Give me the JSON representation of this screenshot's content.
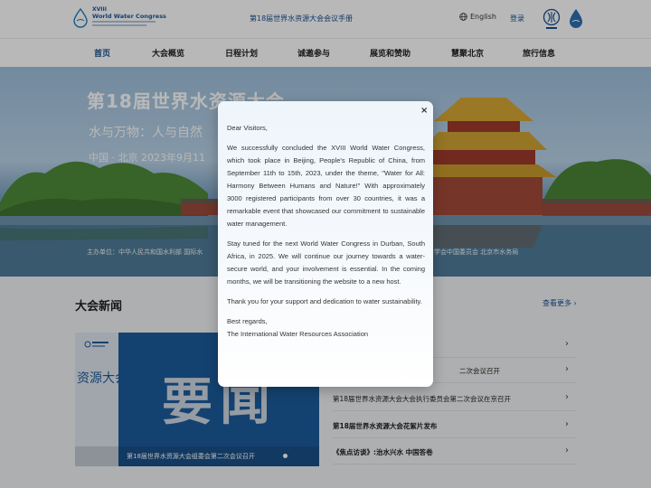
{
  "header": {
    "logo_line1": "XVIII",
    "logo_line2": "World Water Congress",
    "manual_link": "第18届世界水资源大会会议手册",
    "language": "English",
    "login": "登录"
  },
  "nav": {
    "items": [
      "首页",
      "大会概览",
      "日程计划",
      "诚邀参与",
      "展览和赞助",
      "慧聚北京",
      "旅行信息"
    ],
    "active": "首页"
  },
  "hero": {
    "title": "第18届世界水资源大会",
    "subtitle": "水与万物：人与自然",
    "place_date": "中国 · 北京  2023年9月11",
    "sponsors_left": "主办单位：中华人民共和国水利部  国际水",
    "sponsors_right": "学会中国委员会   北京市水务局"
  },
  "news": {
    "section_title": "大会新闻",
    "more_link": "查看更多",
    "image": {
      "vertical_text": "资源大会",
      "big_text": "要闻",
      "caption": "第18届世界水资源大会组委会第二次会议召开"
    },
    "items": [
      "",
      "二次会议召开",
      "第18届世界水资源大会大会执行委员会第二次会议在京召开",
      "第18届世界水资源大会花絮片发布",
      "《焦点访谈》:治水兴水 中国答卷"
    ]
  },
  "modal": {
    "close": "×",
    "greeting": "Dear Visitors,",
    "paragraph1": "We successfully concluded the XVIII World Water Congress, which took place in Beijing, People's Republic of China, from September 11th to 15th, 2023, under the theme, \"Water for All: Harmony Between Humans and Nature!\" With approximately 3000 registered participants from over 30 countries, it was a remarkable event that showcased our commitment to sustainable water management.",
    "paragraph2": "Stay tuned for the next World Water Congress in Durban, South Africa, in 2025. We will continue our journey towards a water-secure world, and your involvement is essential. In the coming months, we will be transitioning the website to a new host.",
    "paragraph3": "Thank you for your support and dedication to water sustainability.",
    "signoff": "Best regards,",
    "signature": "The International Water Resources Association"
  },
  "colors": {
    "brand_blue": "#1a4f8f",
    "overlay": "rgba(0,0,0,0.28)"
  }
}
